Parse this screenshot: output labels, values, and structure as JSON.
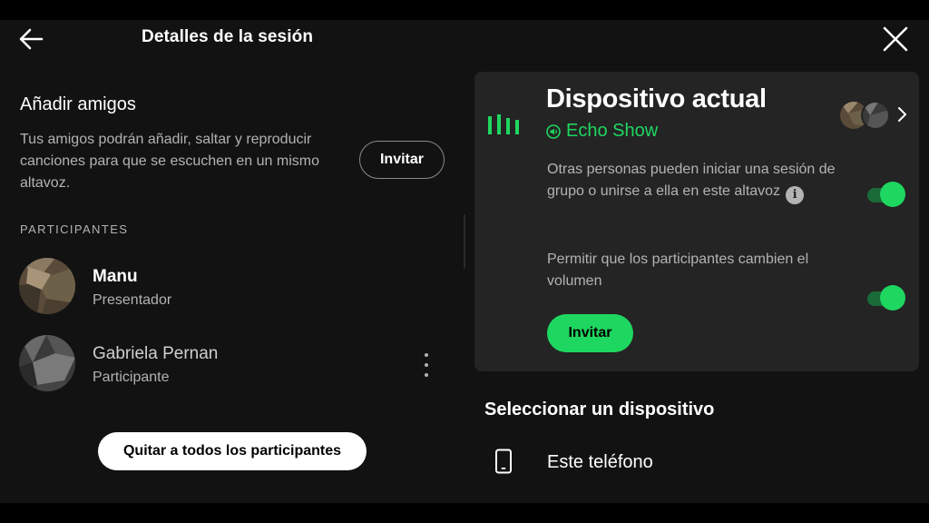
{
  "header": {
    "title": "Detalles de la sesión"
  },
  "add_friends": {
    "title": "Añadir amigos",
    "description": "Tus amigos podrán añadir, saltar y reproducir canciones para que se escuchen en un mismo altavoz.",
    "invite_label": "Invitar"
  },
  "participants": {
    "section_label": "PARTICIPANTES",
    "items": [
      {
        "name": "Manu",
        "role": "Presentador"
      },
      {
        "name": "Gabriela Pernan",
        "role": "Participante"
      }
    ]
  },
  "remove_all_label": "Quitar a todos los participantes",
  "current_device": {
    "title": "Dispositivo actual",
    "device_name": "Echo Show",
    "options": [
      {
        "text": "Otras personas pueden iniciar una sesión de grupo o unirse a ella en este altavoz",
        "enabled": true,
        "has_info": true
      },
      {
        "text": "Permitir que los participantes cambien el volumen",
        "enabled": true,
        "has_info": false
      }
    ],
    "invite_label": "Invitar"
  },
  "select_device": {
    "title": "Seleccionar un dispositivo",
    "devices": [
      {
        "label": "Este teléfono"
      }
    ]
  },
  "colors": {
    "accent": "#1ed760",
    "background": "#121212",
    "card": "#242424",
    "secondary_text": "#b3b3b3"
  },
  "icons": {
    "back": "arrow-left-icon",
    "close": "close-x-icon",
    "equalizer": "equalizer-icon",
    "speaker": "speaker-icon",
    "info": "info-icon",
    "more": "more-vertical-icon",
    "chevron": "chevron-right-icon",
    "phone": "smartphone-icon"
  }
}
